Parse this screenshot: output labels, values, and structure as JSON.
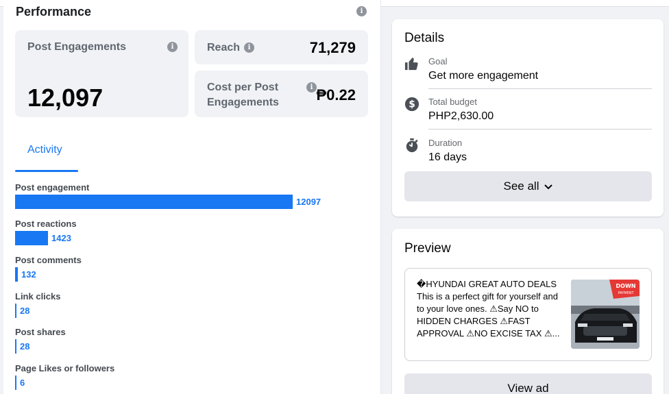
{
  "performance": {
    "title": "Performance",
    "post_engagements": {
      "label": "Post Engagements",
      "value": "12,097"
    },
    "reach": {
      "label": "Reach",
      "value": "71,279"
    },
    "cost_per_post": {
      "label": "Cost per Post Engagements",
      "value": "₱0.22"
    },
    "activity_tab": "Activity",
    "metrics": [
      {
        "label": "Post engagement",
        "value": "12097",
        "fraction": 1.0
      },
      {
        "label": "Post reactions",
        "value": "1423",
        "fraction": 0.1176
      },
      {
        "label": "Post comments",
        "value": "132",
        "fraction": 0.0109
      },
      {
        "label": "Link clicks",
        "value": "28",
        "fraction": 0.0023
      },
      {
        "label": "Post shares",
        "value": "28",
        "fraction": 0.0023
      },
      {
        "label": "Page Likes or followers",
        "value": "6",
        "fraction": 0.0005
      }
    ]
  },
  "details": {
    "title": "Details",
    "goal": {
      "label": "Goal",
      "value": "Get more engagement",
      "icon": "thumbs-up-icon"
    },
    "budget": {
      "label": "Total budget",
      "value": "PHP2,630.00",
      "icon": "dollar-icon"
    },
    "duration": {
      "label": "Duration",
      "value": "16 days",
      "icon": "stopwatch-icon"
    },
    "see_all": "See all"
  },
  "preview": {
    "title": "Preview",
    "ad_text": "�HYUNDAI GREAT AUTO DEALS This is a perfect gift for yourself and to your love ones. ⚠Say NO to HIDDEN CHARGES ⚠FAST APPROVAL ⚠NO EXCISE TAX ⚠...",
    "thumb_badge": "DOWN PAYMENT",
    "view_ad": "View ad"
  },
  "colors": {
    "accent": "#1877f2",
    "card_bg": "#f0f2f5",
    "button_bg": "#e4e6eb"
  }
}
